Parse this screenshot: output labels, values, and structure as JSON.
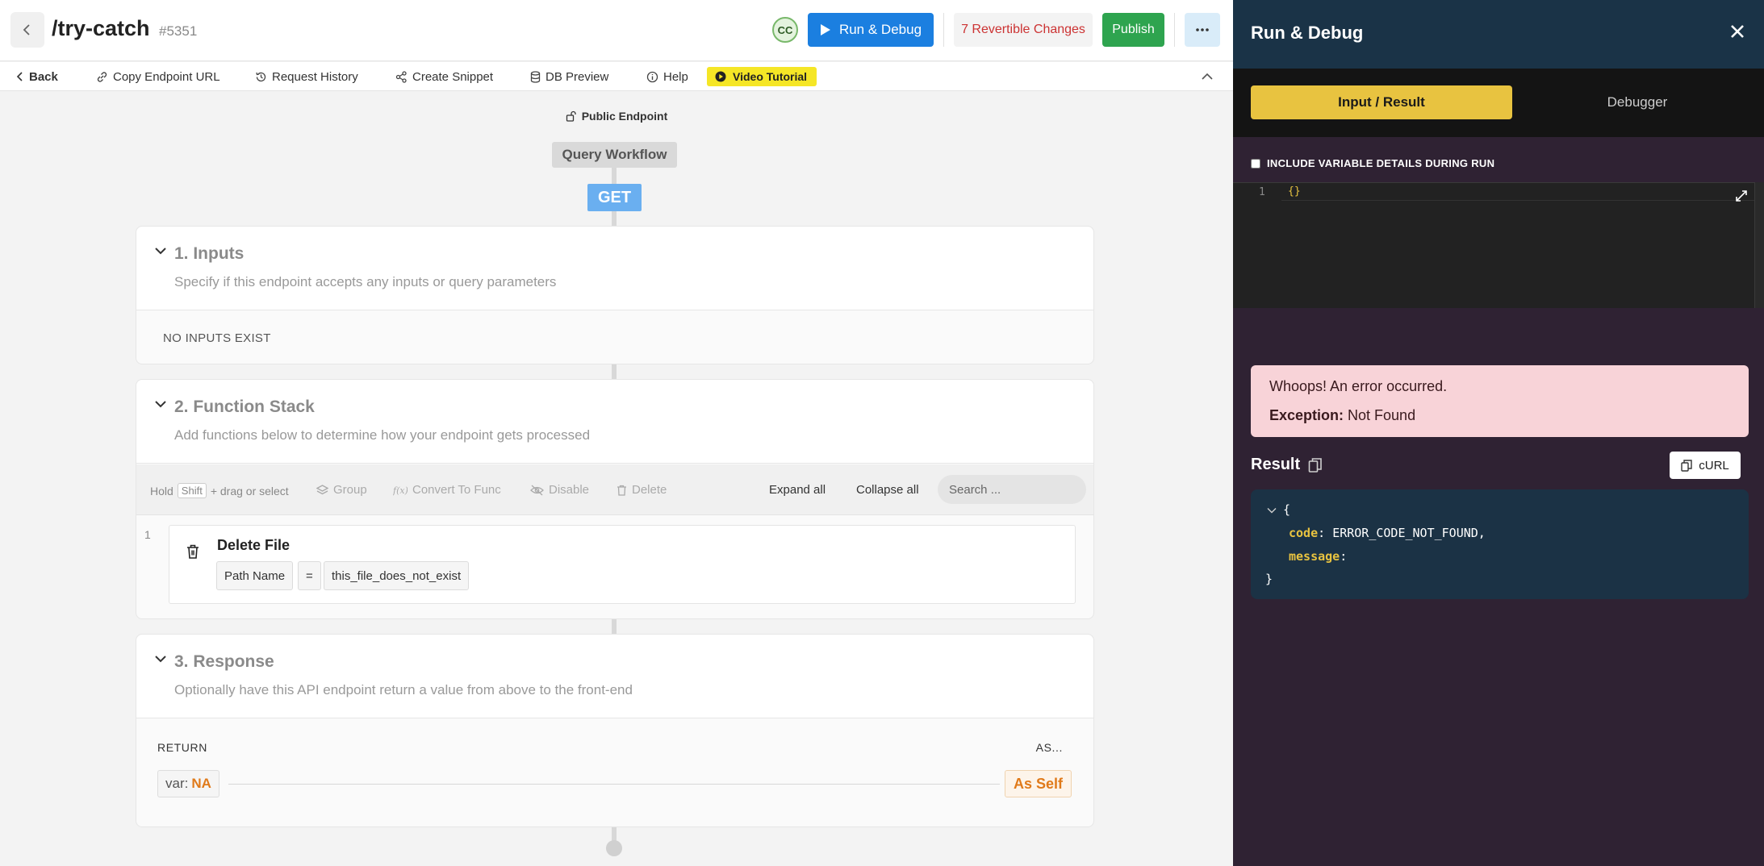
{
  "header": {
    "title": "/try-catch",
    "id": "#5351",
    "avatar_initials": "CC",
    "run_debug_label": "Run & Debug",
    "revertible_label": "7 Revertible Changes",
    "publish_label": "Publish"
  },
  "toolbar": {
    "back": "Back",
    "copy_url": "Copy Endpoint URL",
    "request_history": "Request History",
    "create_snippet": "Create Snippet",
    "db_preview": "DB Preview",
    "help": "Help",
    "video_tutorial": "Video Tutorial"
  },
  "canvas": {
    "public_endpoint": "Public Endpoint",
    "query_workflow": "Query Workflow",
    "method": "GET"
  },
  "inputs": {
    "title": "1. Inputs",
    "description": "Specify if this endpoint accepts any inputs or query parameters",
    "empty": "NO INPUTS EXIST"
  },
  "function_stack": {
    "title": "2. Function Stack",
    "description": "Add functions below to determine how your endpoint gets processed",
    "hint_hold": "Hold",
    "hint_key": "Shift",
    "hint_rest": "+ drag or select",
    "group": "Group",
    "convert": "Convert To Func",
    "disable": "Disable",
    "delete": "Delete",
    "expand_all": "Expand all",
    "collapse_all": "Collapse all",
    "search_placeholder": "Search ...",
    "functions": [
      {
        "index": "1",
        "name": "Delete File",
        "param": "Path Name",
        "op": "=",
        "value": "this_file_does_not_exist"
      }
    ]
  },
  "response": {
    "title": "3. Response",
    "description": "Optionally have this API endpoint return a value from above to the front-end",
    "return_label": "RETURN",
    "as_label": "AS...",
    "var_prefix": "var:",
    "var_value": "NA",
    "as_value": "As Self"
  },
  "panel": {
    "title": "Run & Debug",
    "tab_active": "Input / Result",
    "tab_inactive": "Debugger",
    "include_label": "INCLUDE VARIABLE DETAILS DURING RUN",
    "editor_line": "1",
    "editor_code": "{}",
    "error_title": "Whoops! An error occurred.",
    "error_exception_label": "Exception:",
    "error_exception_value": "Not Found",
    "result_label": "Result",
    "curl_label": "cURL",
    "json_open": "{",
    "json_code_key": "code",
    "json_code_value": "ERROR_CODE_NOT_FOUND,",
    "json_message_key": "message",
    "json_close": "}"
  },
  "colors": {
    "primary_blue": "#1b7fe0",
    "publish_green": "#2ea44f",
    "accent_yellow": "#e8c340",
    "panel_head": "#1a3347",
    "error_bg": "#f8d3d8",
    "orange": "#e07a1a"
  }
}
